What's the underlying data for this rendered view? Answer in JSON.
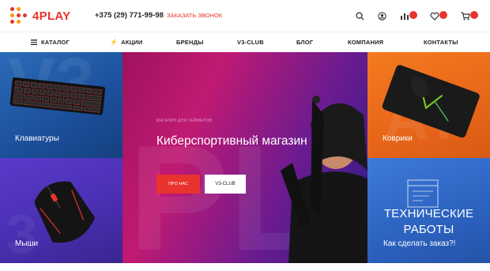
{
  "header": {
    "logo_text": "4PLAY",
    "phone": "+375 (29) 771-99-98",
    "callback_label": "ЗАКАЗАТЬ ЗВОНОК",
    "icons": [
      "search-icon",
      "user-icon",
      "compare-icon",
      "heart-icon",
      "cart-icon"
    ],
    "brand_color": "#e8332f"
  },
  "nav": {
    "items": [
      {
        "label": "КАТАЛОГ",
        "icon": "grid-icon"
      },
      {
        "label": "АКЦИИ",
        "icon": "lightning-icon"
      },
      {
        "label": "БРЕНДЫ"
      },
      {
        "label": "V3-CLUB"
      },
      {
        "label": "БЛОГ"
      },
      {
        "label": "КОМПАНИЯ"
      },
      {
        "label": "КОНТАКТЫ"
      }
    ]
  },
  "tiles": {
    "keyboards": "Клавиатуры",
    "mice": "Мыши",
    "mousepads": "Коврики",
    "how_to_order": "Как сделать заказ?!"
  },
  "hero": {
    "subtitle": "МАГАЗИН ДЛЯ ГЕЙМЕРОВ",
    "title": "Киберспортивный магазин",
    "button_about": "ПРО НАС",
    "button_club": "V3-CLUB"
  },
  "maintenance": {
    "line1": "ТЕХНИЧЕСКИЕ",
    "line2": "РАБОТЫ"
  }
}
